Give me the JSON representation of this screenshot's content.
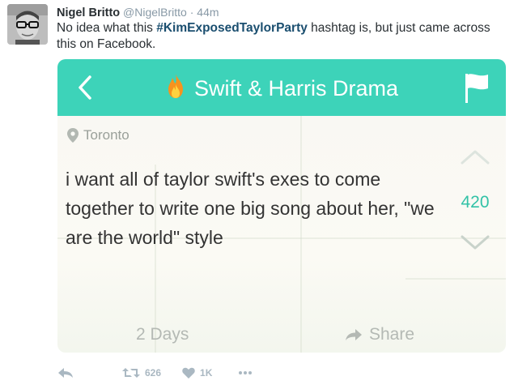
{
  "tweet": {
    "author_name": "Nigel Britto",
    "author_handle": "@NigelBritto",
    "separator": "·",
    "time": "44m",
    "text_before": "No idea what this ",
    "hashtag": "#KimExposedTaylorParty",
    "text_after": " hashtag is, but just came across this on Facebook."
  },
  "card": {
    "header_title": "Swift & Harris Drama",
    "location": "Toronto",
    "post_text": "i want all of taylor swift's exes to come together to write one big song about her, \"we are the world\" style",
    "score": "420",
    "age": "2 Days",
    "share_label": "Share",
    "colors": {
      "header": "#3dd3b9",
      "score": "#32c2a7"
    },
    "icons": [
      "back-icon",
      "fire-icon",
      "flag-icon",
      "pin-icon",
      "upvote-icon",
      "downvote-icon",
      "share-arrow-icon"
    ]
  },
  "actions": {
    "retweet_count": "626",
    "like_count": "1K",
    "icons": [
      "reply-icon",
      "retweet-icon",
      "heart-icon",
      "more-icon"
    ]
  }
}
